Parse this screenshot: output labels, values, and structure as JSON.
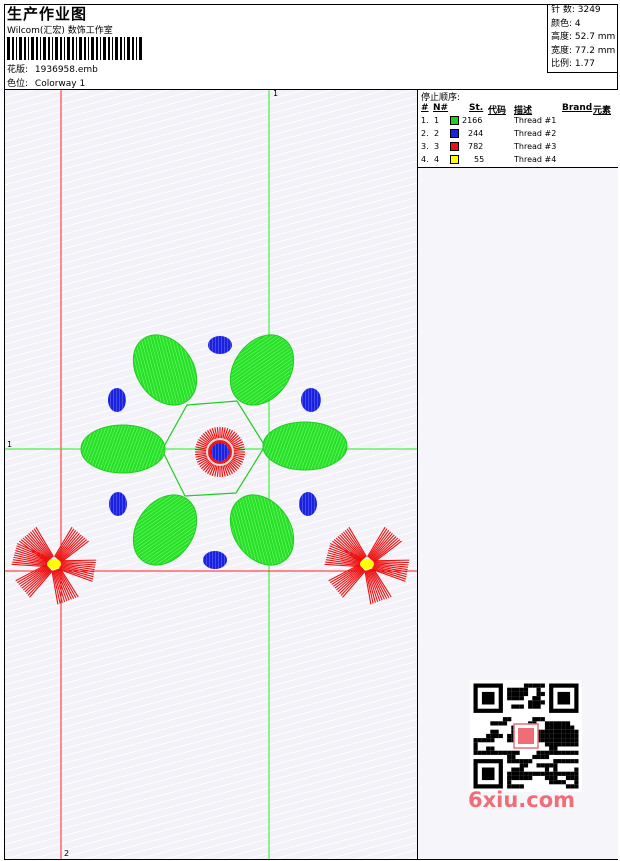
{
  "header": {
    "title": "生产作业图",
    "subtitle": "Wilcom(汇宏) 数饰工作室",
    "design_label": "花版:",
    "design_value": "1936958.emb",
    "colorway_label": "色位:",
    "colorway_value": "Colorway 1"
  },
  "stats": {
    "stitches": "针 数: 3249",
    "colors": "颜色: 4",
    "height": "高度: 52.7 mm",
    "width": "宽度: 77.2 mm",
    "scale": "比例: 1.77"
  },
  "canvas": {
    "axis_top_label": "1",
    "axis_left_label": "1",
    "axis_bottom_label": "2"
  },
  "sequence": {
    "title": "停止顺序:",
    "headers": {
      "num": "#",
      "n": "N#",
      "st": "St.",
      "code": "代码",
      "desc": "描述",
      "brand": "Brand",
      "element": "元素"
    },
    "rows": [
      {
        "num": "1.",
        "n": "1",
        "color": "#22cc22",
        "st": "2166",
        "desc": "Thread #1"
      },
      {
        "num": "2.",
        "n": "2",
        "color": "#1a22dd",
        "st": "244",
        "desc": "Thread #2"
      },
      {
        "num": "3.",
        "n": "3",
        "color": "#ee1111",
        "st": "782",
        "desc": "Thread #3"
      },
      {
        "num": "4.",
        "n": "4",
        "color": "#ffff00",
        "st": "55",
        "desc": "Thread #4"
      }
    ]
  },
  "watermark": {
    "logo_text": "6xiu.com"
  }
}
